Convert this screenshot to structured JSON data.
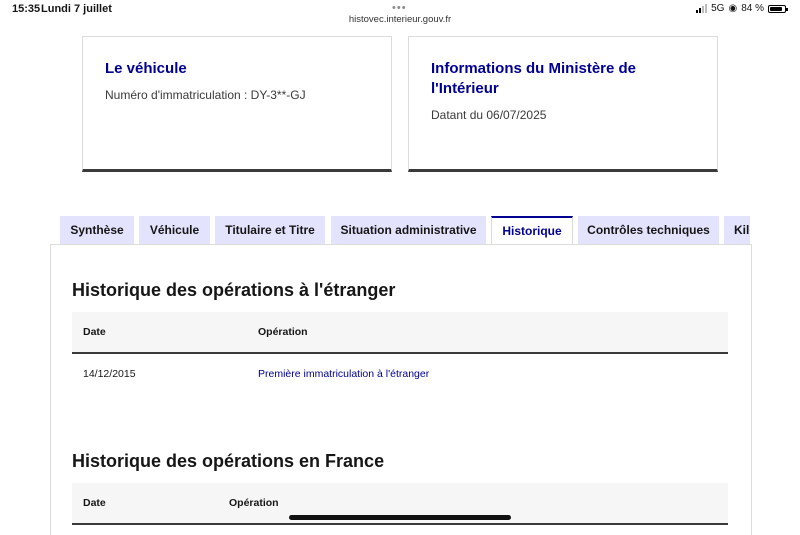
{
  "status_bar": {
    "time": "15:35",
    "date": "Lundi 7 juillet",
    "url": "histovec.interieur.gouv.fr",
    "network": "5G",
    "battery": "84 %",
    "battery_level": 0.84
  },
  "cards": {
    "vehicle": {
      "title": "Le véhicule",
      "text": "Numéro d'immatriculation : DY-3**-GJ"
    },
    "ministry": {
      "title": "Informations du Ministère de l'Intérieur",
      "text": "Datant du 06/07/2025"
    }
  },
  "tabs": [
    {
      "label": "Synthèse",
      "active": false
    },
    {
      "label": "Véhicule",
      "active": false
    },
    {
      "label": "Titulaire et Titre",
      "active": false
    },
    {
      "label": "Situation administrative",
      "active": false
    },
    {
      "label": "Historique",
      "active": true
    },
    {
      "label": "Contrôles techniques",
      "active": false
    },
    {
      "label": "Kil",
      "active": false
    }
  ],
  "foreign_history": {
    "title": "Historique des opérations à l'étranger",
    "columns": [
      "Date",
      "Opération"
    ],
    "rows": [
      {
        "date": "14/12/2015",
        "operation": "Première immatriculation à l'étranger"
      }
    ]
  },
  "france_history": {
    "title": "Historique des opérations en France",
    "columns": [
      "Date",
      "Opération"
    ]
  }
}
